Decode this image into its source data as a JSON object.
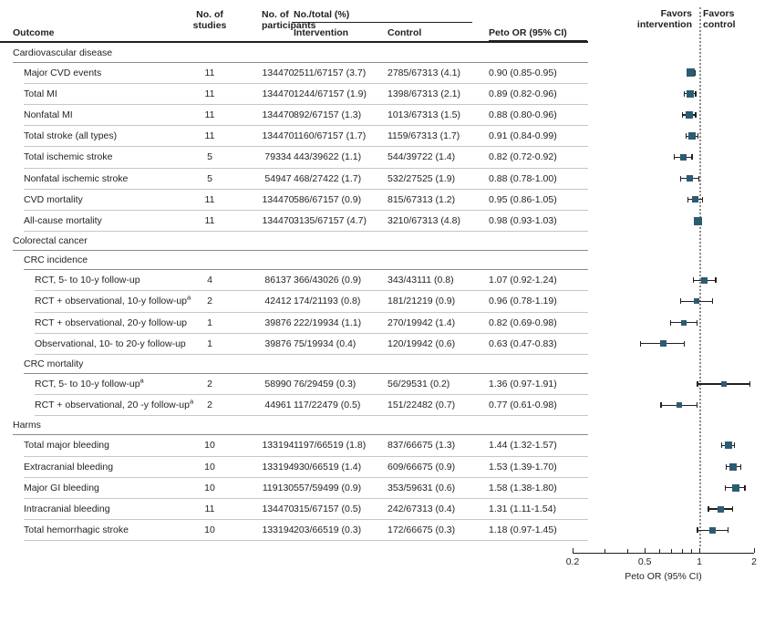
{
  "header": {
    "outcome": "Outcome",
    "no_studies_l1": "No. of",
    "no_studies_l2": "studies",
    "no_participants_l1": "No. of",
    "no_participants_l2": "participants",
    "no_total_pct": "No./total (%)",
    "intervention": "Intervention",
    "control": "Control",
    "peto_or": "Peto OR (95% CI)",
    "favors_intervention_l1": "Favors",
    "favors_intervention_l2": "intervention",
    "favors_control_l1": "Favors",
    "favors_control_l2": "control"
  },
  "axis": {
    "title": "Peto OR (95% CI)",
    "ticks_labeled": [
      "0.2",
      "0.5",
      "1",
      "2"
    ],
    "tick_values": [
      0.2,
      0.5,
      1,
      2
    ],
    "minor_tick_values": [
      0.3,
      0.4,
      0.6,
      0.7,
      0.8,
      0.9
    ],
    "min": 0.2,
    "max": 2,
    "scale": "log",
    "reference_value": 1
  },
  "colors": {
    "marker": "#2b5c72",
    "text": "#231f20",
    "rule": "#231f20",
    "row_rule": "#c9c6c4",
    "reference_line": "#8d8a88"
  },
  "chart_data": {
    "type": "forest",
    "title": "",
    "xlabel": "Peto OR (95% CI)",
    "ylabel": "",
    "xlim": [
      0.2,
      2
    ],
    "xscale": "log",
    "reference_line": 1,
    "columns": [
      "Outcome",
      "No. of studies",
      "No. of participants",
      "Intervention",
      "Control",
      "Peto OR (95% CI)"
    ],
    "rows": [
      {
        "kind": "section",
        "level": 0,
        "label": "Cardiovascular disease"
      },
      {
        "kind": "data",
        "level": 1,
        "label": "Major CVD events",
        "studies": "11",
        "participants": "134470",
        "intervention": "2511/67157 (3.7)",
        "control": "2785/67313 (4.1)",
        "or_text": "0.90 (0.85-0.95)",
        "or": 0.9,
        "lcl": 0.85,
        "ucl": 0.95,
        "weight": 9
      },
      {
        "kind": "data",
        "level": 1,
        "label": "Total MI",
        "studies": "11",
        "participants": "134470",
        "intervention": "1244/67157 (1.9)",
        "control": "1398/67313 (2.1)",
        "or_text": "0.89 (0.82-0.96)",
        "or": 0.89,
        "lcl": 0.82,
        "ucl": 0.96,
        "weight": 8
      },
      {
        "kind": "data",
        "level": 1,
        "label": "Nonfatal MI",
        "studies": "11",
        "participants": "134470",
        "intervention": "892/67157 (1.3)",
        "control": "1013/67313 (1.5)",
        "or_text": "0.88 (0.80-0.96)",
        "or": 0.88,
        "lcl": 0.8,
        "ucl": 0.96,
        "weight": 8
      },
      {
        "kind": "data",
        "level": 1,
        "label": "Total stroke (all types)",
        "studies": "11",
        "participants": "134470",
        "intervention": "1160/67157 (1.7)",
        "control": "1159/67313 (1.7)",
        "or_text": "0.91 (0.84-0.99)",
        "or": 0.91,
        "lcl": 0.84,
        "ucl": 0.99,
        "weight": 8
      },
      {
        "kind": "data",
        "level": 1,
        "label": "Total ischemic stroke",
        "studies": "5",
        "participants": "79334",
        "intervention": "443/39622 (1.1)",
        "control": "544/39722 (1.4)",
        "or_text": "0.82 (0.72-0.92)",
        "or": 0.82,
        "lcl": 0.72,
        "ucl": 0.92,
        "weight": 7
      },
      {
        "kind": "data",
        "level": 1,
        "label": "Nonfatal ischemic stroke",
        "studies": "5",
        "participants": "54947",
        "intervention": "468/27422 (1.7)",
        "control": "532/27525 (1.9)",
        "or_text": "0.88 (0.78-1.00)",
        "or": 0.88,
        "lcl": 0.78,
        "ucl": 1.0,
        "weight": 7
      },
      {
        "kind": "data",
        "level": 1,
        "label": "CVD mortality",
        "studies": "11",
        "participants": "134470",
        "intervention": "586/67157 (0.9)",
        "control": "815/67313 (1.2)",
        "or_text": "0.95 (0.86-1.05)",
        "or": 0.95,
        "lcl": 0.86,
        "ucl": 1.05,
        "weight": 7
      },
      {
        "kind": "data",
        "level": 1,
        "label": "All-cause mortality",
        "studies": "11",
        "participants": "134470",
        "intervention": "3135/67157 (4.7)",
        "control": "3210/67313 (4.8)",
        "or_text": "0.98 (0.93-1.03)",
        "or": 0.98,
        "lcl": 0.93,
        "ucl": 1.03,
        "weight": 9
      },
      {
        "kind": "section",
        "level": 0,
        "label": "Colorectal cancer"
      },
      {
        "kind": "section",
        "level": 1,
        "label": "CRC incidence"
      },
      {
        "kind": "data",
        "level": 2,
        "label": "RCT, 5- to 10-y follow-up",
        "studies": "4",
        "participants": "86137",
        "intervention": "366/43026 (0.9)",
        "control": "343/43111 (0.8)",
        "or_text": "1.07 (0.92-1.24)",
        "or": 1.07,
        "lcl": 0.92,
        "ucl": 1.24,
        "weight": 7
      },
      {
        "kind": "data",
        "level": 2,
        "label": "RCT + observational, 10-y follow-up",
        "sup": "a",
        "studies": "2",
        "participants": "42412",
        "intervention": "174/21193 (0.8)",
        "control": "181/21219 (0.9)",
        "or_text": "0.96 (0.78-1.19)",
        "or": 0.96,
        "lcl": 0.78,
        "ucl": 1.19,
        "weight": 6
      },
      {
        "kind": "data",
        "level": 2,
        "label": "RCT + observational, 20-y follow-up",
        "studies": "1",
        "participants": "39876",
        "intervention": "222/19934 (1.1)",
        "control": "270/19942 (1.4)",
        "or_text": "0.82 (0.69-0.98)",
        "or": 0.82,
        "lcl": 0.69,
        "ucl": 0.98,
        "weight": 6
      },
      {
        "kind": "data",
        "level": 2,
        "label": "Observational, 10- to 20-y follow-up",
        "studies": "1",
        "participants": "39876",
        "intervention": "75/19934 (0.4)",
        "control": "120/19942 (0.6)",
        "or_text": "0.63 (0.47-0.83)",
        "or": 0.63,
        "lcl": 0.47,
        "ucl": 0.83,
        "weight": 7
      },
      {
        "kind": "section",
        "level": 1,
        "label": "CRC mortality"
      },
      {
        "kind": "data",
        "level": 2,
        "label": "RCT, 5- to 10-y follow-up",
        "sup": "a",
        "studies": "2",
        "participants": "58990",
        "intervention": "76/29459 (0.3)",
        "control": "56/29531 (0.2)",
        "or_text": "1.36 (0.97-1.91)",
        "or": 1.36,
        "lcl": 0.97,
        "ucl": 1.91,
        "weight": 6
      },
      {
        "kind": "data",
        "level": 2,
        "label": "RCT + observational, 20 -y follow-up",
        "sup": "a",
        "studies": "2",
        "participants": "44961",
        "intervention": "117/22479 (0.5)",
        "control": "151/22482 (0.7)",
        "or_text": "0.77 (0.61-0.98)",
        "or": 0.77,
        "lcl": 0.61,
        "ucl": 0.98,
        "weight": 6
      },
      {
        "kind": "section",
        "level": 0,
        "label": "Harms"
      },
      {
        "kind": "data",
        "level": 1,
        "label": "Total major bleeding",
        "studies": "10",
        "participants": "133194",
        "intervention": "1197/66519 (1.8)",
        "control": "837/66675 (1.3)",
        "or_text": "1.44 (1.32-1.57)",
        "or": 1.44,
        "lcl": 1.32,
        "ucl": 1.57,
        "weight": 8
      },
      {
        "kind": "data",
        "level": 1,
        "label": "Extracranial bleeding",
        "studies": "10",
        "participants": "133194",
        "intervention": "930/66519 (1.4)",
        "control": "609/66675 (0.9)",
        "or_text": "1.53 (1.39-1.70)",
        "or": 1.53,
        "lcl": 1.39,
        "ucl": 1.7,
        "weight": 8
      },
      {
        "kind": "data",
        "level": 1,
        "label": "Major GI bleeding",
        "studies": "10",
        "participants": "119130",
        "intervention": "557/59499 (0.9)",
        "control": "353/59631 (0.6)",
        "or_text": "1.58 (1.38-1.80)",
        "or": 1.58,
        "lcl": 1.38,
        "ucl": 1.8,
        "weight": 8
      },
      {
        "kind": "data",
        "level": 1,
        "label": "Intracranial bleeding",
        "studies": "11",
        "participants": "134470",
        "intervention": "315/67157 (0.5)",
        "control": "242/67313 (0.4)",
        "or_text": "1.31 (1.11-1.54)",
        "or": 1.31,
        "lcl": 1.11,
        "ucl": 1.54,
        "weight": 7
      },
      {
        "kind": "data",
        "level": 1,
        "label": "Total hemorrhagic stroke",
        "studies": "10",
        "participants": "133194",
        "intervention": "203/66519 (0.3)",
        "control": "172/66675 (0.3)",
        "or_text": "1.18 (0.97-1.45)",
        "or": 1.18,
        "lcl": 0.97,
        "ucl": 1.45,
        "weight": 7
      }
    ]
  }
}
